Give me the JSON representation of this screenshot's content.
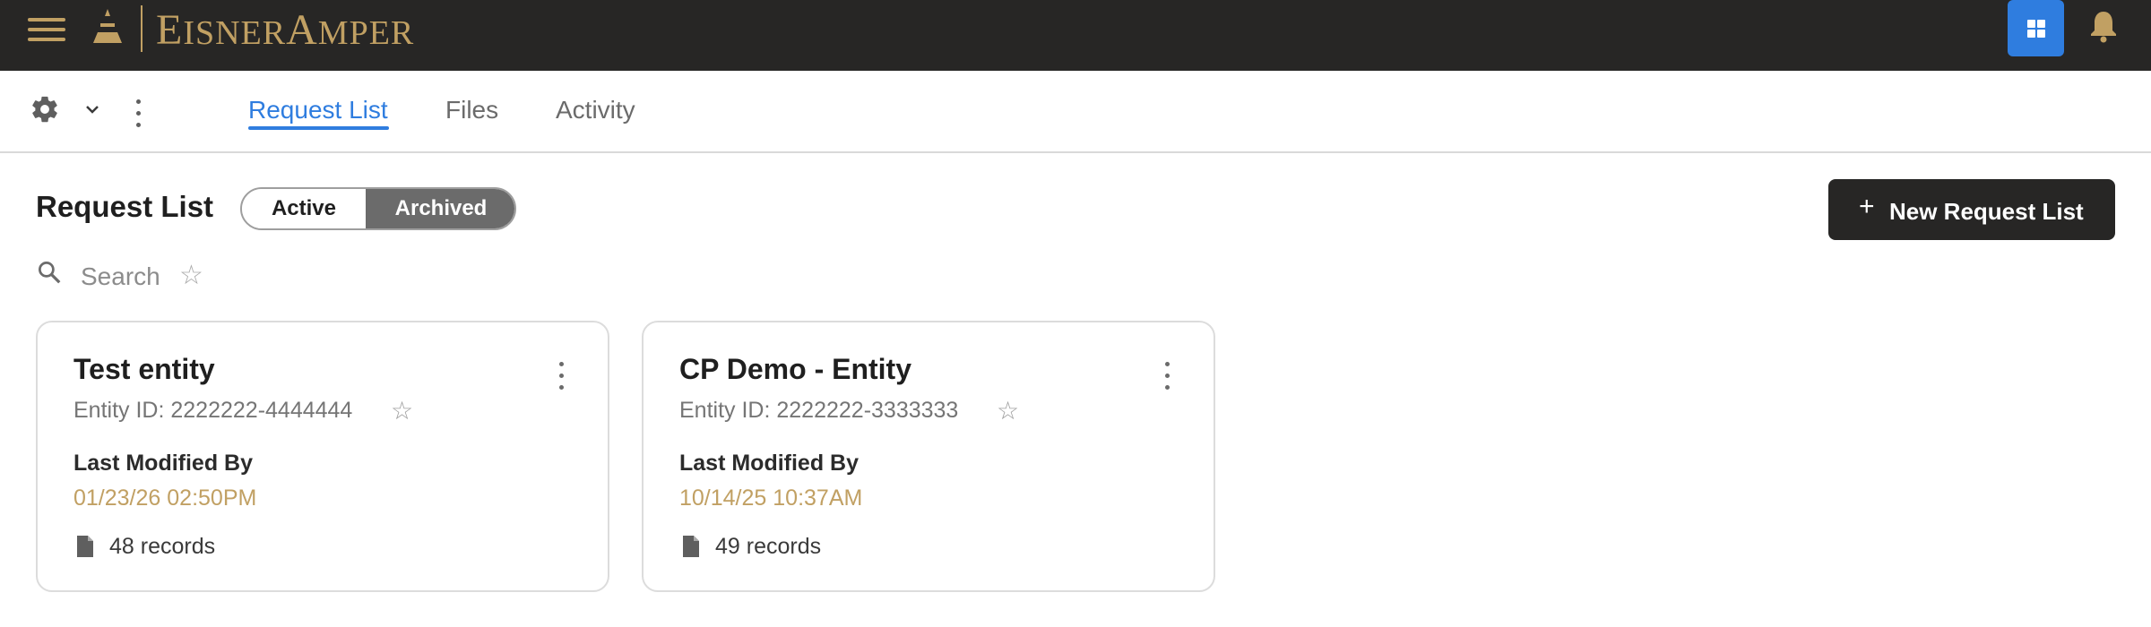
{
  "appbar": {
    "logo_first": "E",
    "logo_rest": "ISNER",
    "logo_second_first": "A",
    "logo_second_rest": "MPER",
    "accent_color": "#c1a063",
    "apps_icon": "grid-icon",
    "notification_icon": "bell-icon"
  },
  "toolbar": {
    "settings_icon": "gear-icon",
    "tabs": [
      {
        "label": "Request List",
        "active": true
      },
      {
        "label": "Files",
        "active": false
      },
      {
        "label": "Activity",
        "active": false
      }
    ]
  },
  "main": {
    "title": "Request List",
    "filter": {
      "options": [
        "Active",
        "Archived"
      ],
      "selected": "Archived"
    },
    "new_button_icon": "+",
    "new_button_label": "New Request List",
    "search_placeholder": "Search",
    "star_glyph": "☆"
  },
  "cards": [
    {
      "title": "Test entity",
      "entity_id": "Entity ID: 2222222-4444444",
      "last_modified_label": "Last Modified By",
      "last_modified_date": "01/23/26 02:50PM",
      "records": "48 records"
    },
    {
      "title": "CP Demo - Entity",
      "entity_id": "Entity ID: 2222222-3333333",
      "last_modified_label": "Last Modified By",
      "last_modified_date": "10/14/25 10:37AM",
      "records": "49 records"
    }
  ]
}
